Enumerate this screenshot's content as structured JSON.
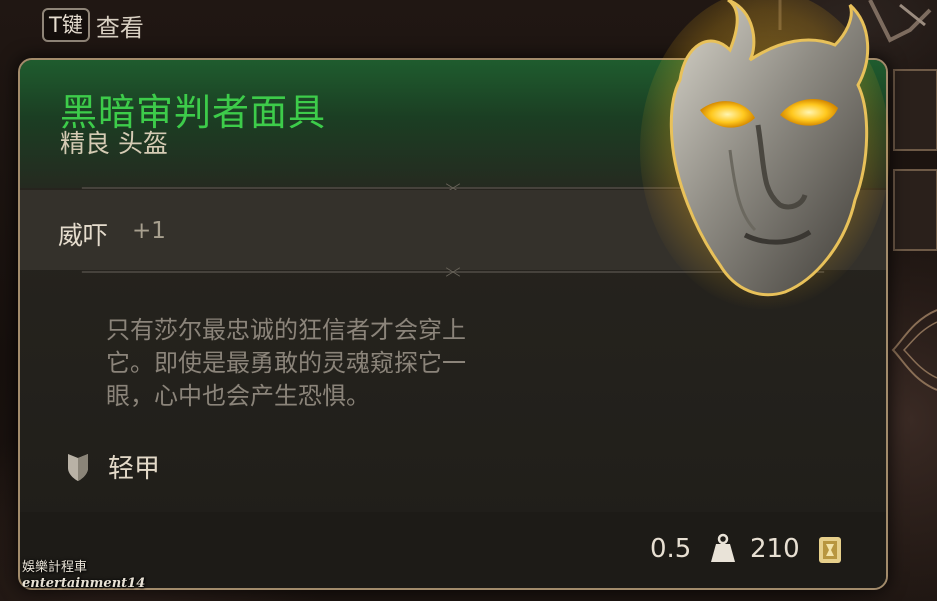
{
  "hint": {
    "key": "T键",
    "label": "查看"
  },
  "item": {
    "name": "黑暗审判者面具",
    "rarity_type": "精良 头盔",
    "name_color": "#3dcc4a"
  },
  "stat": {
    "name": "威吓",
    "value": "+1"
  },
  "description": [
    "只有莎尔最忠诚的狂信者才会穿上",
    "它。即使是最勇敢的灵魂窥探它一",
    "眼，心中也会产生恐惧。"
  ],
  "armor": {
    "icon": "shield-icon",
    "label": "轻甲"
  },
  "footer": {
    "weight": "0.5",
    "weight_icon": "weight-icon",
    "value": "210",
    "value_icon": "gold-coin-icon"
  },
  "watermark": {
    "line1": "娛樂計程車",
    "line2": "entertainment14"
  }
}
